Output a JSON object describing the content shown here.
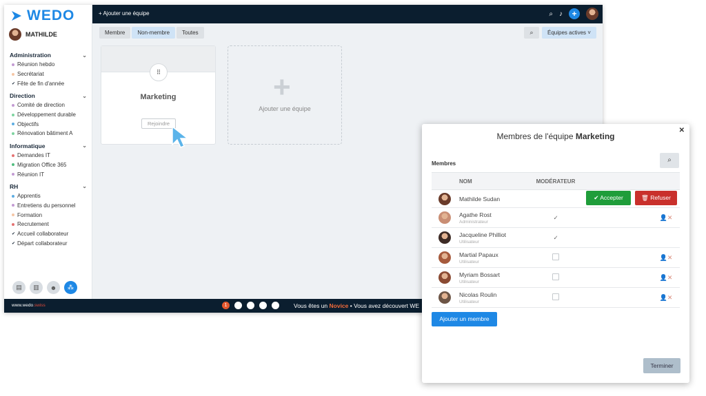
{
  "app": {
    "logo": "WEDO",
    "user": "MATHILDE"
  },
  "sidebar": {
    "groups": [
      {
        "title": "Administration",
        "items": [
          {
            "label": "Réunion hebdo",
            "color": "#c39bd3",
            "type": "dot"
          },
          {
            "label": "Secrétariat",
            "color": "#f5c6a5",
            "type": "dot"
          },
          {
            "label": "Fête de fin d'année",
            "type": "check"
          }
        ]
      },
      {
        "title": "Direction",
        "items": [
          {
            "label": "Comité de direction",
            "color": "#c39bd3",
            "type": "dot"
          },
          {
            "label": "Développement durable",
            "color": "#7ed4a0",
            "type": "dot"
          },
          {
            "label": "Objectifs",
            "color": "#5dade2",
            "type": "dot"
          },
          {
            "label": "Rénovation bâtiment A",
            "color": "#7ed4a0",
            "type": "dot"
          }
        ]
      },
      {
        "title": "Informatique",
        "items": [
          {
            "label": "Demandes IT",
            "color": "#e57373",
            "type": "dot"
          },
          {
            "label": "Migration Office 365",
            "color": "#52be80",
            "type": "dot"
          },
          {
            "label": "Réunion IT",
            "color": "#c39bd3",
            "type": "dot"
          }
        ]
      },
      {
        "title": "RH",
        "items": [
          {
            "label": "Apprentis",
            "color": "#5dade2",
            "type": "dot"
          },
          {
            "label": "Entretiens du personnel",
            "color": "#c39bd3",
            "type": "dot"
          },
          {
            "label": "Formation",
            "color": "#f5c6a5",
            "type": "dot"
          },
          {
            "label": "Recrutement",
            "color": "#e57373",
            "type": "dot"
          },
          {
            "label": "Accueil collaborateur",
            "type": "check"
          },
          {
            "label": "Départ collaborateur",
            "type": "check"
          }
        ]
      }
    ]
  },
  "topbar": {
    "add_team": "+ Ajouter une équipe"
  },
  "filters": {
    "tabs": [
      "Membre",
      "Non-membre",
      "Toutes"
    ],
    "active_tab": "Non-membre",
    "teams_filter": "Équipes actives ˅"
  },
  "team_card": {
    "title": "Marketing",
    "join": "Rejoindre"
  },
  "add_card": {
    "label": "Ajouter une équipe"
  },
  "footer": {
    "brand": "www.wedo",
    "brand_suffix": ".swiss",
    "msg_prefix": "Vous êtes un ",
    "msg_level": "Novice",
    "msg_suffix": " • Vous avez découvert WE"
  },
  "modal": {
    "title_prefix": "Membres de l'équipe ",
    "title_team": "Marketing",
    "section": "Membres",
    "col_name": "NOM",
    "col_mod": "MODÉRATEUR",
    "pending": {
      "name": "Mathilde Sudan",
      "accept": "Accepter",
      "refuse": "Refuser"
    },
    "members": [
      {
        "name": "Agathe Rost",
        "role": "Administrateur",
        "moderator": true,
        "removable": true
      },
      {
        "name": "Jacqueline Philliot",
        "role": "Utilisateur",
        "moderator": true,
        "removable": false
      },
      {
        "name": "Martial Papaux",
        "role": "Utilisateur",
        "moderator": false,
        "removable": true
      },
      {
        "name": "Myriam Bossart",
        "role": "Utilisateur",
        "moderator": false,
        "removable": true
      },
      {
        "name": "Nicolas Roulin",
        "role": "Utilisateur",
        "moderator": false,
        "removable": true
      }
    ],
    "add_member": "Ajouter un membre",
    "done": "Terminer"
  }
}
